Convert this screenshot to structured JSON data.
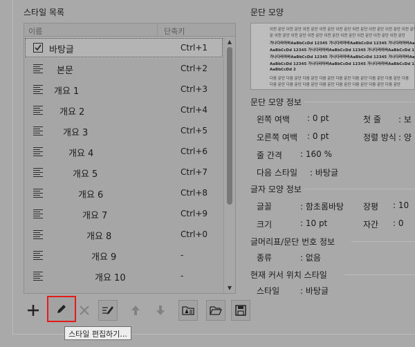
{
  "sections": {
    "style_list": "스타일 목록",
    "paragraph_shape": "문단 모양",
    "paragraph_info": "문단 모양 정보",
    "char_info": "글자 모양 정보",
    "bullet_info": "글머리표/문단 번호 정보",
    "cursor_style": "현재 커서 위치 스타일"
  },
  "list": {
    "col_name": "이름",
    "col_shortcut": "단축키",
    "rows": [
      {
        "name": "바탕글",
        "shortcut": "Ctrl+1"
      },
      {
        "name": "본문",
        "shortcut": "Ctrl+2"
      },
      {
        "name": "개요 1",
        "shortcut": "Ctrl+3"
      },
      {
        "name": "개요 2",
        "shortcut": "Ctrl+4"
      },
      {
        "name": "개요 3",
        "shortcut": "Ctrl+5"
      },
      {
        "name": "개요 4",
        "shortcut": "Ctrl+6"
      },
      {
        "name": "개요 5",
        "shortcut": "Ctrl+7"
      },
      {
        "name": "개요 6",
        "shortcut": "Ctrl+8"
      },
      {
        "name": "개요 7",
        "shortcut": "Ctrl+9"
      },
      {
        "name": "개요 8",
        "shortcut": "Ctrl+0"
      },
      {
        "name": "개요 9",
        "shortcut": "-"
      },
      {
        "name": "개요 10",
        "shortcut": "-"
      }
    ]
  },
  "preview": {
    "lines": [
      "이전 문단 이전 문단 이전 문단 이전 문단 이전 문단 이전 문단 이전 문단 이전 문단 이전 문단",
      "문 이전 문단 이전 문단 이전 문단 이전 문단 이전 문단 이전 문단 이전 문단 이전 문단",
      "가나다라마바AaBbCcDd 12345 가나다라마바AaBbCcDd 12345 가나다라마바AaBbCcDd 12345",
      "AaBbCcDd 12345 가나다라마바AaBbCcDd 12345 가나다라마바AaBbCcDd 12345 가나다라마바",
      "가나다라마바AaBbCcDd 12345 가나다라마바AaBbCcDd 12345 가나다라마바AaBbCcDd 12345",
      "AaBbCcDd 12345 가나다라마바AaBbCcDd 12345 가나다라마바AaBbCcDd 12345 가나다라마바",
      "AaBbCcDd 2",
      "다음 문단 다음 문단 다음 문단 다음 문단 다음 문단 다음 문단 다음 문단 다음 문단 다음",
      "다음 문단 다음 문단 다음 문단 다음 문단 다음 문단 다음 문단 다음 문단 다음 문단"
    ]
  },
  "paragraph": {
    "left_margin_label": "왼쪽 여백",
    "left_margin_value": ": 0 pt",
    "first_line_label": "첫 줄",
    "first_line_value": ": 보",
    "right_margin_label": "오른쪽 여백",
    "right_margin_value": ": 0 pt",
    "align_label": "정렬 방식",
    "align_value": ": 양",
    "line_spacing_label": "줄 간격",
    "line_spacing_value": ": 160 %",
    "next_style_label": "다음 스타일",
    "next_style_value": ": 바탕글"
  },
  "character": {
    "font_label": "글꼴",
    "font_value": ": 함초롬바탕",
    "ratio_label": "장평",
    "ratio_value": ": 10",
    "size_label": "크기",
    "size_value": ": 10 pt",
    "spacing_label": "자간",
    "spacing_value": ": 0"
  },
  "bullet": {
    "kind_label": "종류",
    "kind_value": ": 없음"
  },
  "cursor": {
    "style_label": "스타일",
    "style_value": ": 바탕글"
  },
  "toolbar": {
    "tooltip": "스타일 편집하기..."
  },
  "colors": {
    "highlight": "#e31b1b",
    "background": "#a9a9a9"
  }
}
